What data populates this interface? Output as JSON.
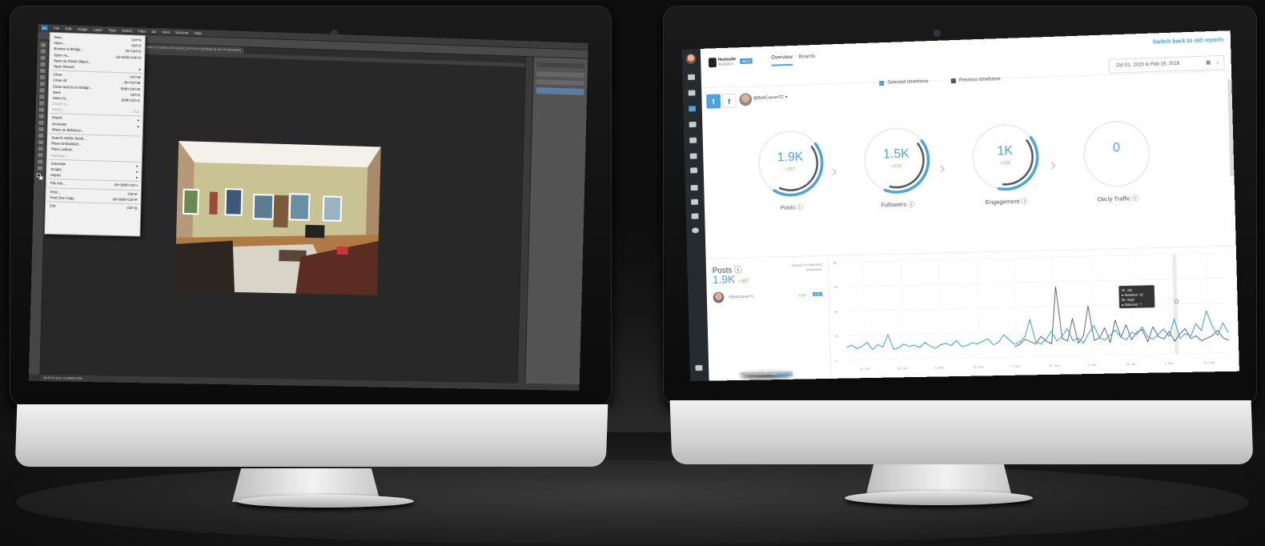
{
  "left_monitor": {
    "photoshop": {
      "logo": "Ps",
      "menubar": [
        "File",
        "Edit",
        "Image",
        "Layer",
        "Type",
        "Select",
        "Filter",
        "3D",
        "View",
        "Window",
        "Help"
      ],
      "document_tab": "Bundle-1 at Gallo, Cervera(1)_0079.exn (RGB/8) @ 66.7% (RGB/8#)",
      "file_menu": [
        {
          "label": "New...",
          "shortcut": "Ctrl+N"
        },
        {
          "label": "Open...",
          "shortcut": "Ctrl+O"
        },
        {
          "label": "Browse in Bridge...",
          "shortcut": "Alt+Ctrl+O"
        },
        {
          "label": "Open As...",
          "shortcut": "Alt+Shift+Ctrl+O"
        },
        {
          "label": "Open as Smart Object...",
          "shortcut": ""
        },
        {
          "label": "Open Recent",
          "shortcut": "▸"
        },
        {
          "sep": true
        },
        {
          "label": "Close",
          "shortcut": "Ctrl+W"
        },
        {
          "label": "Close All",
          "shortcut": "Alt+Ctrl+W"
        },
        {
          "label": "Close and Go to Bridge...",
          "shortcut": "Shift+Ctrl+W"
        },
        {
          "label": "Save",
          "shortcut": "Ctrl+S"
        },
        {
          "label": "Save As...",
          "shortcut": "Shift+Ctrl+S"
        },
        {
          "label": "Check In...",
          "shortcut": "",
          "disabled": true
        },
        {
          "label": "Revert",
          "shortcut": "F12",
          "disabled": true
        },
        {
          "sep": true
        },
        {
          "label": "Export",
          "shortcut": "▸"
        },
        {
          "label": "Generate",
          "shortcut": "▸"
        },
        {
          "label": "Share on Behance...",
          "shortcut": ""
        },
        {
          "sep": true
        },
        {
          "label": "Search Adobe Stock...",
          "shortcut": ""
        },
        {
          "label": "Place Embedded...",
          "shortcut": ""
        },
        {
          "label": "Place Linked...",
          "shortcut": ""
        },
        {
          "label": "Package...",
          "shortcut": "",
          "disabled": true
        },
        {
          "sep": true
        },
        {
          "label": "Automate",
          "shortcut": "▸"
        },
        {
          "label": "Scripts",
          "shortcut": "▸"
        },
        {
          "label": "Import",
          "shortcut": "▸"
        },
        {
          "sep": true
        },
        {
          "label": "File Info...",
          "shortcut": "Alt+Shift+Ctrl+I"
        },
        {
          "sep": true
        },
        {
          "label": "Print...",
          "shortcut": "Ctrl+P"
        },
        {
          "label": "Print One Copy",
          "shortcut": "Alt+Shift+Ctrl+P"
        },
        {
          "sep": true
        },
        {
          "label": "Exit",
          "shortcut": "Ctrl+Q"
        }
      ],
      "status": "66.67%    Doc: 5.93M/5.93M"
    }
  },
  "right_monitor": {
    "hootsuite": {
      "logo_line1": "Hootsuite",
      "logo_line2": "Analytics",
      "beta": "BETA",
      "nav": [
        "Overview",
        "Boards"
      ],
      "switch_link": "Switch back to old reports",
      "date_range": "Oct 01, 2015 to Feb 19, 2016",
      "handle": "@BobCarverTC",
      "legend": {
        "selected": "Selected timeframe",
        "previous": "Previous timeframe"
      },
      "colors": {
        "accent": "#4aa3df",
        "previous": "#555555",
        "positive": "#6cbf52",
        "sidebar": "#262b2f"
      },
      "metrics": [
        {
          "value": "1.9K",
          "delta": "+307",
          "label": "Posts ⓘ",
          "fraction": 0.8
        },
        {
          "value": "1.5K",
          "delta": "+376",
          "label": "Followers ⓘ",
          "fraction": 0.75
        },
        {
          "value": "1K",
          "delta": "+235",
          "label": "Engagement ⓘ",
          "fraction": 0.7
        },
        {
          "value": "0",
          "delta": "",
          "label": "Ow.ly Traffic ⓘ",
          "fraction": 0
        }
      ],
      "lower": {
        "title": "Posts ⓘ",
        "big": "1.9K",
        "big_delta": "+307",
        "note": "Based on selected timeframe",
        "account": "@BobCarverTC",
        "account_delta": "+307",
        "account_value": "1.9K",
        "footer_text": "Find more other with",
        "footer_link": "Suggestions"
      },
      "tooltip": [
        "15. Jan",
        "● Statuses: 42",
        "05. Sept",
        "● Statuses: 7"
      ]
    }
  },
  "chart_data": {
    "type": "line",
    "x_tick_labels": [
      "12. Oct",
      "26. Oct",
      "9. Nov",
      "23. Nov",
      "7. Dec",
      "21. Dec",
      "4. Jan",
      "18. Jan",
      "1. Feb",
      "15. Feb"
    ],
    "y_tick_labels": [
      "0",
      "20",
      "40",
      "60",
      "80"
    ],
    "ylim": [
      0,
      80
    ],
    "series": [
      {
        "name": "Selected timeframe",
        "values": [
          10,
          12,
          9,
          11,
          14,
          8,
          12,
          10,
          20,
          8,
          9,
          12,
          10,
          11,
          9,
          13,
          10,
          8,
          11,
          12,
          10,
          14,
          9,
          10,
          12,
          11,
          13,
          15,
          10,
          12,
          18,
          14,
          10,
          12,
          16,
          30,
          12,
          10,
          14,
          20,
          12,
          16,
          22,
          12,
          14,
          10,
          18,
          24,
          14,
          12,
          16,
          20,
          14,
          12,
          18,
          16,
          22,
          14,
          12,
          16,
          20,
          14,
          28,
          12,
          16,
          14,
          24,
          18,
          34,
          22,
          14,
          24,
          16
        ]
      },
      {
        "name": "Previous timeframe",
        "values": [
          0,
          0,
          0,
          0,
          0,
          0,
          0,
          0,
          0,
          0,
          0,
          0,
          0,
          0,
          0,
          0,
          0,
          0,
          0,
          0,
          0,
          0,
          0,
          0,
          0,
          0,
          0,
          0,
          0,
          0,
          0,
          0,
          8,
          10,
          14,
          12,
          10,
          16,
          12,
          10,
          56,
          14,
          12,
          30,
          10,
          16,
          40,
          12,
          14,
          22,
          10,
          28,
          14,
          24,
          12,
          18,
          20,
          10,
          22,
          14,
          12,
          18,
          10,
          16,
          20,
          12,
          14,
          10,
          12,
          14,
          18,
          12,
          10
        ]
      }
    ],
    "grid": true,
    "legend_placement": "top"
  }
}
